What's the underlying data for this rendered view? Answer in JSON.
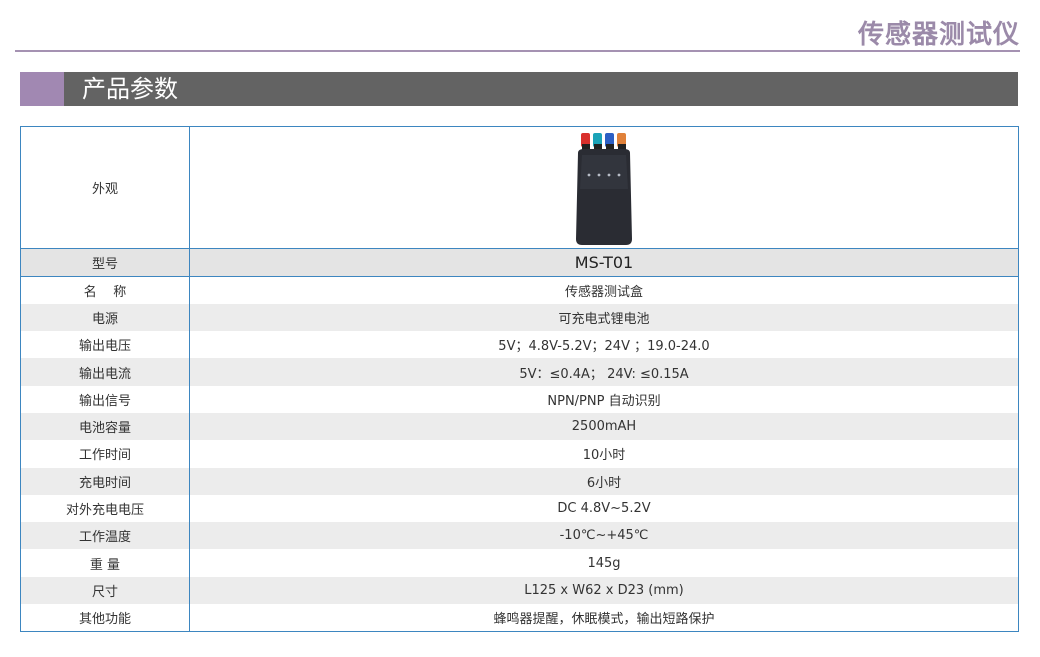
{
  "header": {
    "title": "传感器测试仪"
  },
  "section": {
    "title": "产品参数"
  },
  "product": {
    "appearance_label": "外观",
    "image_icon": "sensor-tester-device-photo",
    "model_label": "型号",
    "model_value": "MS-T01"
  },
  "specs": [
    {
      "label": "名    称",
      "value": "传感器测试盒"
    },
    {
      "label": "电源",
      "value": "可充电式锂电池"
    },
    {
      "label": "输出电压",
      "value": "5V；4.8V-5.2V；24V ；19.0-24.0"
    },
    {
      "label": "输出电流",
      "value": "5V：≤0.4A； 24V: ≤0.15A"
    },
    {
      "label": "输出信号",
      "value": "NPN/PNP 自动识别"
    },
    {
      "label": "电池容量",
      "value": "2500mAH"
    },
    {
      "label": "工作时间",
      "value": "10小时"
    },
    {
      "label": "充电时间",
      "value": "6小时"
    },
    {
      "label": "对外充电电压",
      "value": "DC 4.8V~5.2V"
    },
    {
      "label": "工作温度",
      "value": "-10℃~+45℃"
    },
    {
      "label": "重 量",
      "value": "145g"
    },
    {
      "label": "尺寸",
      "value": "L125 x W62 x D23 (mm)"
    },
    {
      "label": "其他功能",
      "value": "蜂鸣器提醒，休眠模式，输出短路保护"
    }
  ],
  "colors": {
    "title": "#9b8aa9",
    "rule": "#a592b2",
    "section_bar": "#636363",
    "section_accent": "#a188b2",
    "table_border": "#3d86c0",
    "row_alt": "#ececec",
    "connector_red": "#d9302c",
    "connector_teal": "#1aa3b8",
    "connector_blue": "#2c5fc4",
    "connector_orange": "#e0813a"
  }
}
